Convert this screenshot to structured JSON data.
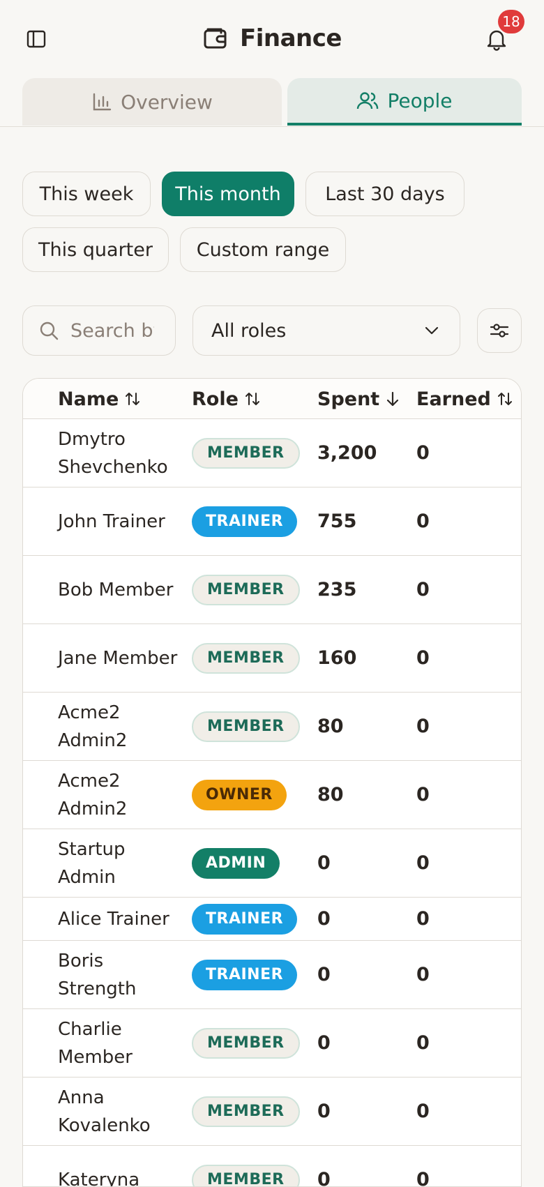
{
  "header": {
    "title": "Finance",
    "notification_count": "18"
  },
  "tabs": [
    {
      "label": "Overview",
      "active": false
    },
    {
      "label": "People",
      "active": true
    }
  ],
  "period_chips": [
    {
      "label": "This week",
      "active": false
    },
    {
      "label": "This month",
      "active": true
    },
    {
      "label": "Last 30 days",
      "active": false
    },
    {
      "label": "This quarter",
      "active": false
    },
    {
      "label": "Custom range",
      "active": false
    }
  ],
  "filters": {
    "search_placeholder": "Search by",
    "role_select_value": "All roles"
  },
  "table": {
    "columns": {
      "name": "Name",
      "role": "Role",
      "spent": "Spent",
      "earned": "Earned"
    },
    "rows": [
      {
        "name": "Dmytro Shevchenko",
        "role": "MEMBER",
        "spent": "3,200",
        "earned": "0"
      },
      {
        "name": "John Trainer",
        "role": "TRAINER",
        "spent": "755",
        "earned": "0"
      },
      {
        "name": "Bob Member",
        "role": "MEMBER",
        "spent": "235",
        "earned": "0"
      },
      {
        "name": "Jane Member",
        "role": "MEMBER",
        "spent": "160",
        "earned": "0"
      },
      {
        "name": "Acme2 Admin2",
        "role": "MEMBER",
        "spent": "80",
        "earned": "0"
      },
      {
        "name": "Acme2 Admin2",
        "role": "OWNER",
        "spent": "80",
        "earned": "0"
      },
      {
        "name": "Startup Admin",
        "role": "ADMIN",
        "spent": "0",
        "earned": "0"
      },
      {
        "name": "Alice Trainer",
        "role": "TRAINER",
        "spent": "0",
        "earned": "0"
      },
      {
        "name": "Boris Strength",
        "role": "TRAINER",
        "spent": "0",
        "earned": "0"
      },
      {
        "name": "Charlie Member",
        "role": "MEMBER",
        "spent": "0",
        "earned": "0"
      },
      {
        "name": "Anna Kovalenko",
        "role": "MEMBER",
        "spent": "0",
        "earned": "0"
      },
      {
        "name": "Kateryna",
        "role": "MEMBER",
        "spent": "0",
        "earned": "0"
      }
    ]
  },
  "colors": {
    "accent": "#0f7e68",
    "badge": "#e03b3b",
    "trainer": "#1b9fe2",
    "owner": "#f3a30f"
  }
}
